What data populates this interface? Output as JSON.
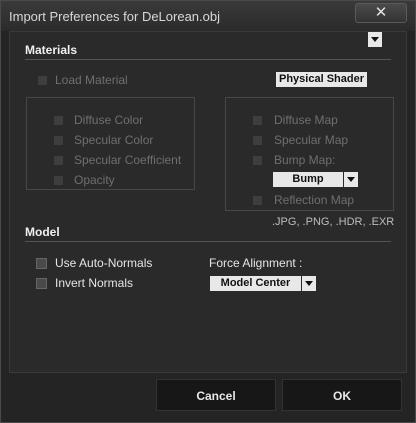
{
  "window": {
    "title": "Import Preferences for DeLorean.obj",
    "close_glyph": "✕"
  },
  "materials": {
    "title": "Materials",
    "load_material": {
      "label": "Load Material",
      "checked": false,
      "enabled": false
    },
    "shader_dropdown": {
      "value": "Physical Shader"
    },
    "left_group": [
      {
        "label": "Diffuse Color"
      },
      {
        "label": "Specular Color"
      },
      {
        "label": "Specular Coefficient"
      },
      {
        "label": "Opacity"
      }
    ],
    "right_group": {
      "diffuse_map": "Diffuse Map",
      "specular_map": "Specular Map",
      "bump_map": "Bump Map:",
      "bump_dropdown": {
        "value": "Bump"
      },
      "reflection_map": "Reflection Map"
    },
    "formats": ".JPG, .PNG, .HDR, .EXR"
  },
  "model": {
    "title": "Model",
    "use_auto_normals": {
      "label": "Use Auto-Normals",
      "checked": false
    },
    "invert_normals": {
      "label": "Invert Normals",
      "checked": false
    },
    "force_alignment": {
      "label": "Force Alignment :",
      "value": "Model Center"
    }
  },
  "buttons": {
    "cancel": "Cancel",
    "ok": "OK"
  },
  "icons": {
    "checkbox": "checkbox-icon",
    "dropdown": "chevron-down-icon",
    "close": "close-icon"
  }
}
